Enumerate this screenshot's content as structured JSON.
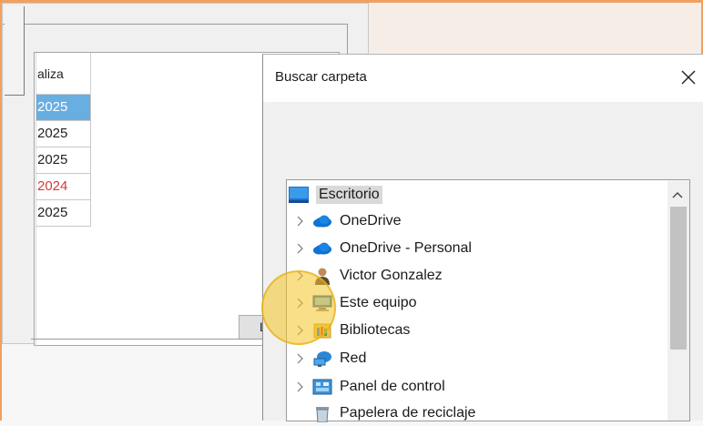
{
  "background_app": {
    "column_header": "aliza",
    "rows": [
      {
        "value": "2025",
        "state": "selected"
      },
      {
        "value": "2025",
        "state": "normal"
      },
      {
        "value": "2025",
        "state": "normal"
      },
      {
        "value": "2024",
        "state": "red"
      },
      {
        "value": "2025",
        "state": "normal"
      }
    ],
    "partial_button_label": "L"
  },
  "dialog": {
    "title": "Buscar carpeta",
    "close_icon": "close-icon",
    "tree": {
      "root": {
        "label": "Escritorio",
        "icon": "desktop-icon"
      },
      "items": [
        {
          "label": "OneDrive",
          "icon": "cloud-icon"
        },
        {
          "label": "OneDrive - Personal",
          "icon": "cloud-icon"
        },
        {
          "label": "Victor Gonzalez",
          "icon": "user-icon"
        },
        {
          "label": "Este equipo",
          "icon": "computer-icon"
        },
        {
          "label": "Bibliotecas",
          "icon": "library-icon"
        },
        {
          "label": "Red",
          "icon": "network-icon"
        },
        {
          "label": "Panel de control",
          "icon": "control-panel-icon"
        },
        {
          "label": "Papelera de reciclaje",
          "icon": "recycle-bin-icon"
        }
      ]
    }
  },
  "colors": {
    "frame_accent": "#f0a060",
    "selection": "#69aee0",
    "red_text": "#d33a3a",
    "cursor_highlight": "#f5c428"
  }
}
